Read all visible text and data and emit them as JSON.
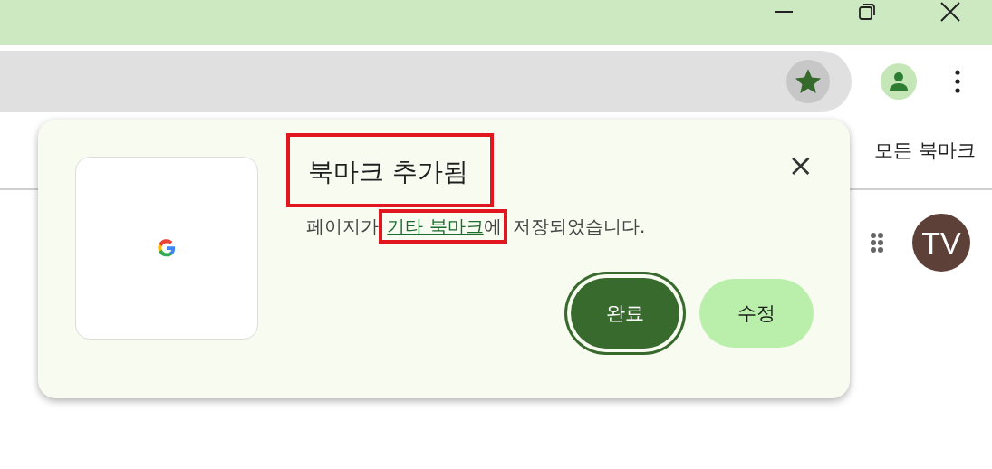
{
  "bookmarks_bar": {
    "all_bookmarks": "모든 북마크"
  },
  "page": {
    "avatar": "TV"
  },
  "bubble": {
    "title": "북마크 추가됨",
    "title_highlighted": true,
    "message": {
      "before": "페이지가 ",
      "link": "기타 북마크",
      "link_suffix": "에",
      "after": " 저장되었습니다.",
      "link_highlighted": true
    },
    "close": "×",
    "buttons": [
      {
        "label": "완료",
        "kind": "primary",
        "focused": true
      },
      {
        "label": "수정",
        "kind": "secondary",
        "focused": false
      }
    ]
  },
  "toolbar": {
    "bookmarked": true
  }
}
